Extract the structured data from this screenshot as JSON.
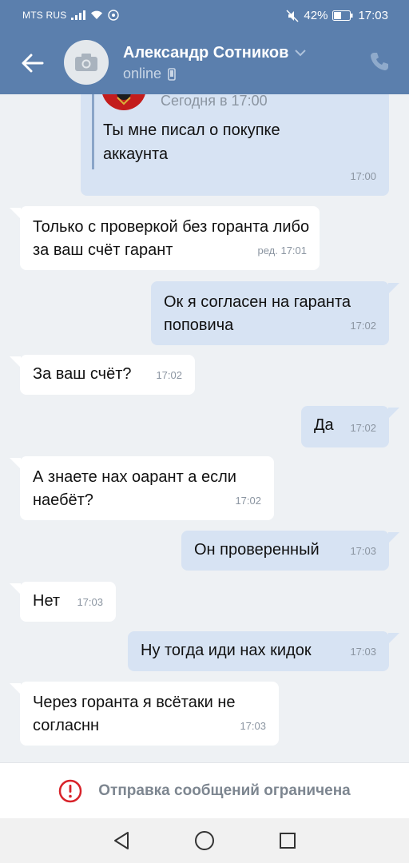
{
  "status_bar": {
    "carrier": "MTS RUS",
    "battery": "42%",
    "time": "17:03"
  },
  "header": {
    "contact_name": "Александр Сотников",
    "status": "online",
    "icons": [
      "back-arrow-icon",
      "camera-icon",
      "chevron-down-icon",
      "mobile-icon",
      "phone-icon"
    ]
  },
  "forwarded": {
    "date": "Сегодня в 17:00",
    "text": "Ты мне писал о покупке аккаунта",
    "time": "17:00"
  },
  "messages": [
    {
      "dir": "in",
      "text": "Только с проверкой без горанта либо за ваш счёт гарант",
      "time": "ред. 17:01"
    },
    {
      "dir": "out",
      "text": "Ок я согласен на гаранта поповича",
      "time": "17:02"
    },
    {
      "dir": "in",
      "text": "За ваш счёт?",
      "time": "17:02"
    },
    {
      "dir": "out",
      "text": "Да",
      "time": "17:02"
    },
    {
      "dir": "in",
      "text": "А знаете нах оарант а если наебёт?",
      "time": "17:02"
    },
    {
      "dir": "out",
      "text": "Он проверенный",
      "time": "17:03"
    },
    {
      "dir": "in",
      "text": "Нет",
      "time": "17:03"
    },
    {
      "dir": "out",
      "text": "Ну тогда иди нах кидок",
      "time": "17:03"
    },
    {
      "dir": "in",
      "text": "Через горанта я всётаки не согласнн",
      "time": "17:03"
    }
  ],
  "restriction": {
    "text": "Отправка сообщений ограничена",
    "icon": "alert-circle-icon"
  },
  "colors": {
    "header": "#5b7fad",
    "incoming": "#ffffff",
    "outgoing": "#d7e3f3",
    "alert": "#d8232a"
  }
}
